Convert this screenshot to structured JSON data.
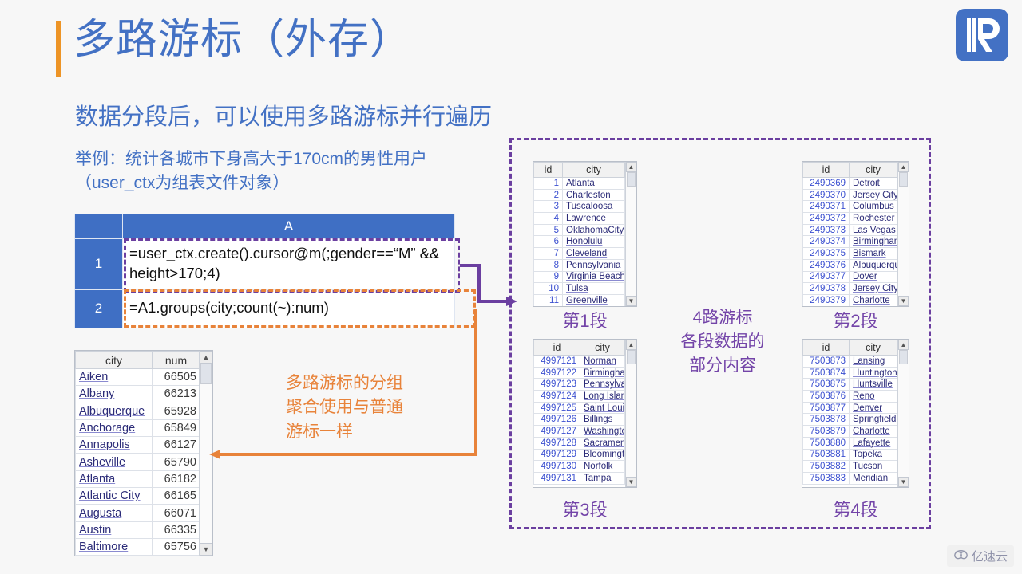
{
  "page": {
    "title": "多路游标（外存）",
    "subtitle": "数据分段后，可以使用多路游标并行遍历",
    "example_line1": "举例：统计各城市下身高大于170cm的男性用户",
    "example_line2": "（user_ctx为组表文件对象）",
    "accent_orange": "#ed9426",
    "accent_blue": "#4371c4",
    "accent_purple": "#6b3fa0"
  },
  "logo": {
    "name": "raqsoft-logo",
    "color": "#4371c4"
  },
  "watermark": {
    "icon": "cloud-icon",
    "text": "亿速云"
  },
  "formula_table": {
    "column_header": "A",
    "rows": [
      {
        "row_label": "1",
        "formula": "=user_ctx.create().cursor@m(;gender==“M” && height>170;4)"
      },
      {
        "row_label": "2",
        "formula": "=A1.groups(city;count(~):num)"
      }
    ]
  },
  "result_table": {
    "headers": [
      "city",
      "num"
    ],
    "rows": [
      [
        "Aiken",
        "66505"
      ],
      [
        "Albany",
        "66213"
      ],
      [
        "Albuquerque",
        "65928"
      ],
      [
        "Anchorage",
        "65849"
      ],
      [
        "Annapolis",
        "66127"
      ],
      [
        "Asheville",
        "65790"
      ],
      [
        "Atlanta",
        "66182"
      ],
      [
        "Atlantic City",
        "66165"
      ],
      [
        "Augusta",
        "66071"
      ],
      [
        "Austin",
        "66335"
      ],
      [
        "Baltimore",
        "65756"
      ]
    ]
  },
  "orange_note": "多路游标的分组聚合使用与普通游标一样",
  "center_note": "4路游标\n各段数据的\n部分内容",
  "center_note_lines": [
    "4路游标",
    "各段数据的",
    "部分内容"
  ],
  "segments": [
    {
      "label": "第1段",
      "headers": [
        "id",
        "city"
      ],
      "rows": [
        [
          "1",
          "Atlanta"
        ],
        [
          "2",
          "Charleston"
        ],
        [
          "3",
          "Tuscaloosa"
        ],
        [
          "4",
          "Lawrence"
        ],
        [
          "5",
          "OklahomaCity"
        ],
        [
          "6",
          "Honolulu"
        ],
        [
          "7",
          "Cleveland"
        ],
        [
          "8",
          "Pennsylvania"
        ],
        [
          "9",
          "Virginia Beach"
        ],
        [
          "10",
          "Tulsa"
        ],
        [
          "11",
          "Greenville"
        ]
      ]
    },
    {
      "label": "第2段",
      "headers": [
        "id",
        "city"
      ],
      "rows": [
        [
          "2490369",
          "Detroit"
        ],
        [
          "2490370",
          "Jersey City"
        ],
        [
          "2490371",
          "Columbus"
        ],
        [
          "2490372",
          "Rochester"
        ],
        [
          "2490373",
          "Las Vegas"
        ],
        [
          "2490374",
          "Birmingham"
        ],
        [
          "2490375",
          "Bismark"
        ],
        [
          "2490376",
          "Albuquerque"
        ],
        [
          "2490377",
          "Dover"
        ],
        [
          "2490378",
          "Jersey City"
        ],
        [
          "2490379",
          "Charlotte"
        ]
      ]
    },
    {
      "label": "第3段",
      "headers": [
        "id",
        "city"
      ],
      "rows": [
        [
          "4997121",
          "Norman"
        ],
        [
          "4997122",
          "Birmingham"
        ],
        [
          "4997123",
          "Pennsylvania"
        ],
        [
          "4997124",
          "Long Island"
        ],
        [
          "4997125",
          "Saint Louis"
        ],
        [
          "4997126",
          "Billings"
        ],
        [
          "4997127",
          "Washington"
        ],
        [
          "4997128",
          "Sacramento"
        ],
        [
          "4997129",
          "Bloomington"
        ],
        [
          "4997130",
          "Norfolk"
        ],
        [
          "4997131",
          "Tampa"
        ]
      ]
    },
    {
      "label": "第4段",
      "headers": [
        "id",
        "city"
      ],
      "rows": [
        [
          "7503873",
          "Lansing"
        ],
        [
          "7503874",
          "Huntington"
        ],
        [
          "7503875",
          "Huntsville"
        ],
        [
          "7503876",
          "Reno"
        ],
        [
          "7503877",
          "Denver"
        ],
        [
          "7503878",
          "Springfield"
        ],
        [
          "7503879",
          "Charlotte"
        ],
        [
          "7503880",
          "Lafayette"
        ],
        [
          "7503881",
          "Topeka"
        ],
        [
          "7503882",
          "Tucson"
        ],
        [
          "7503883",
          "Meridian"
        ]
      ]
    }
  ]
}
